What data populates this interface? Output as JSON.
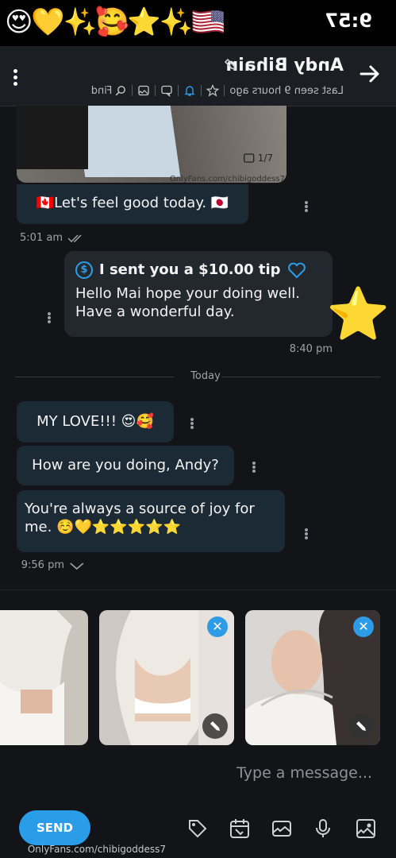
{
  "status": {
    "time": "9:57",
    "emoji_strip": "🇺🇸✨⭐🥰✨💛😍"
  },
  "header": {
    "contact_name": "Andy Bihain",
    "last_seen": "Last seen 9 hours ago",
    "find_label": "Find"
  },
  "messages": {
    "photo_count": "1/7",
    "photo_watermark": "OnlyFans.com/chibigoddess7",
    "msg1": "🇨🇦Let's feel good today. 🇯🇵",
    "ts1": "5:01 am",
    "tip_title": "I sent you a $10.00 tip",
    "tip_body": "Hello Mai hope your doing well. Have a wonderful day.",
    "ts2": "8:40 pm",
    "divider": "Today",
    "msg3": "MY LOVE!!! 😍🥰",
    "msg4": "How are you doing, Andy?",
    "msg5": "You're always a source of joy for me. ☺️💛⭐⭐⭐⭐⭐",
    "ts3": "9:56 pm"
  },
  "composer": {
    "placeholder": "Type a message...",
    "send_label": "SEND",
    "watermark": "OnlyFans.com/chibigoddess7"
  },
  "colors": {
    "accent": "#2a9de8",
    "bubble_in": "#1c2a35",
    "bubble_out": "#23282f",
    "background": "#121418"
  },
  "icons": [
    "back-arrow-icon",
    "pencil-icon",
    "star-icon",
    "bell-icon",
    "chat-icon",
    "image-icon",
    "search-icon",
    "kebab-icon",
    "image-upload-icon",
    "microphone-icon",
    "gallery-icon",
    "calendar-icon",
    "price-tag-icon",
    "dollar-icon",
    "close-icon",
    "edit-icon"
  ]
}
